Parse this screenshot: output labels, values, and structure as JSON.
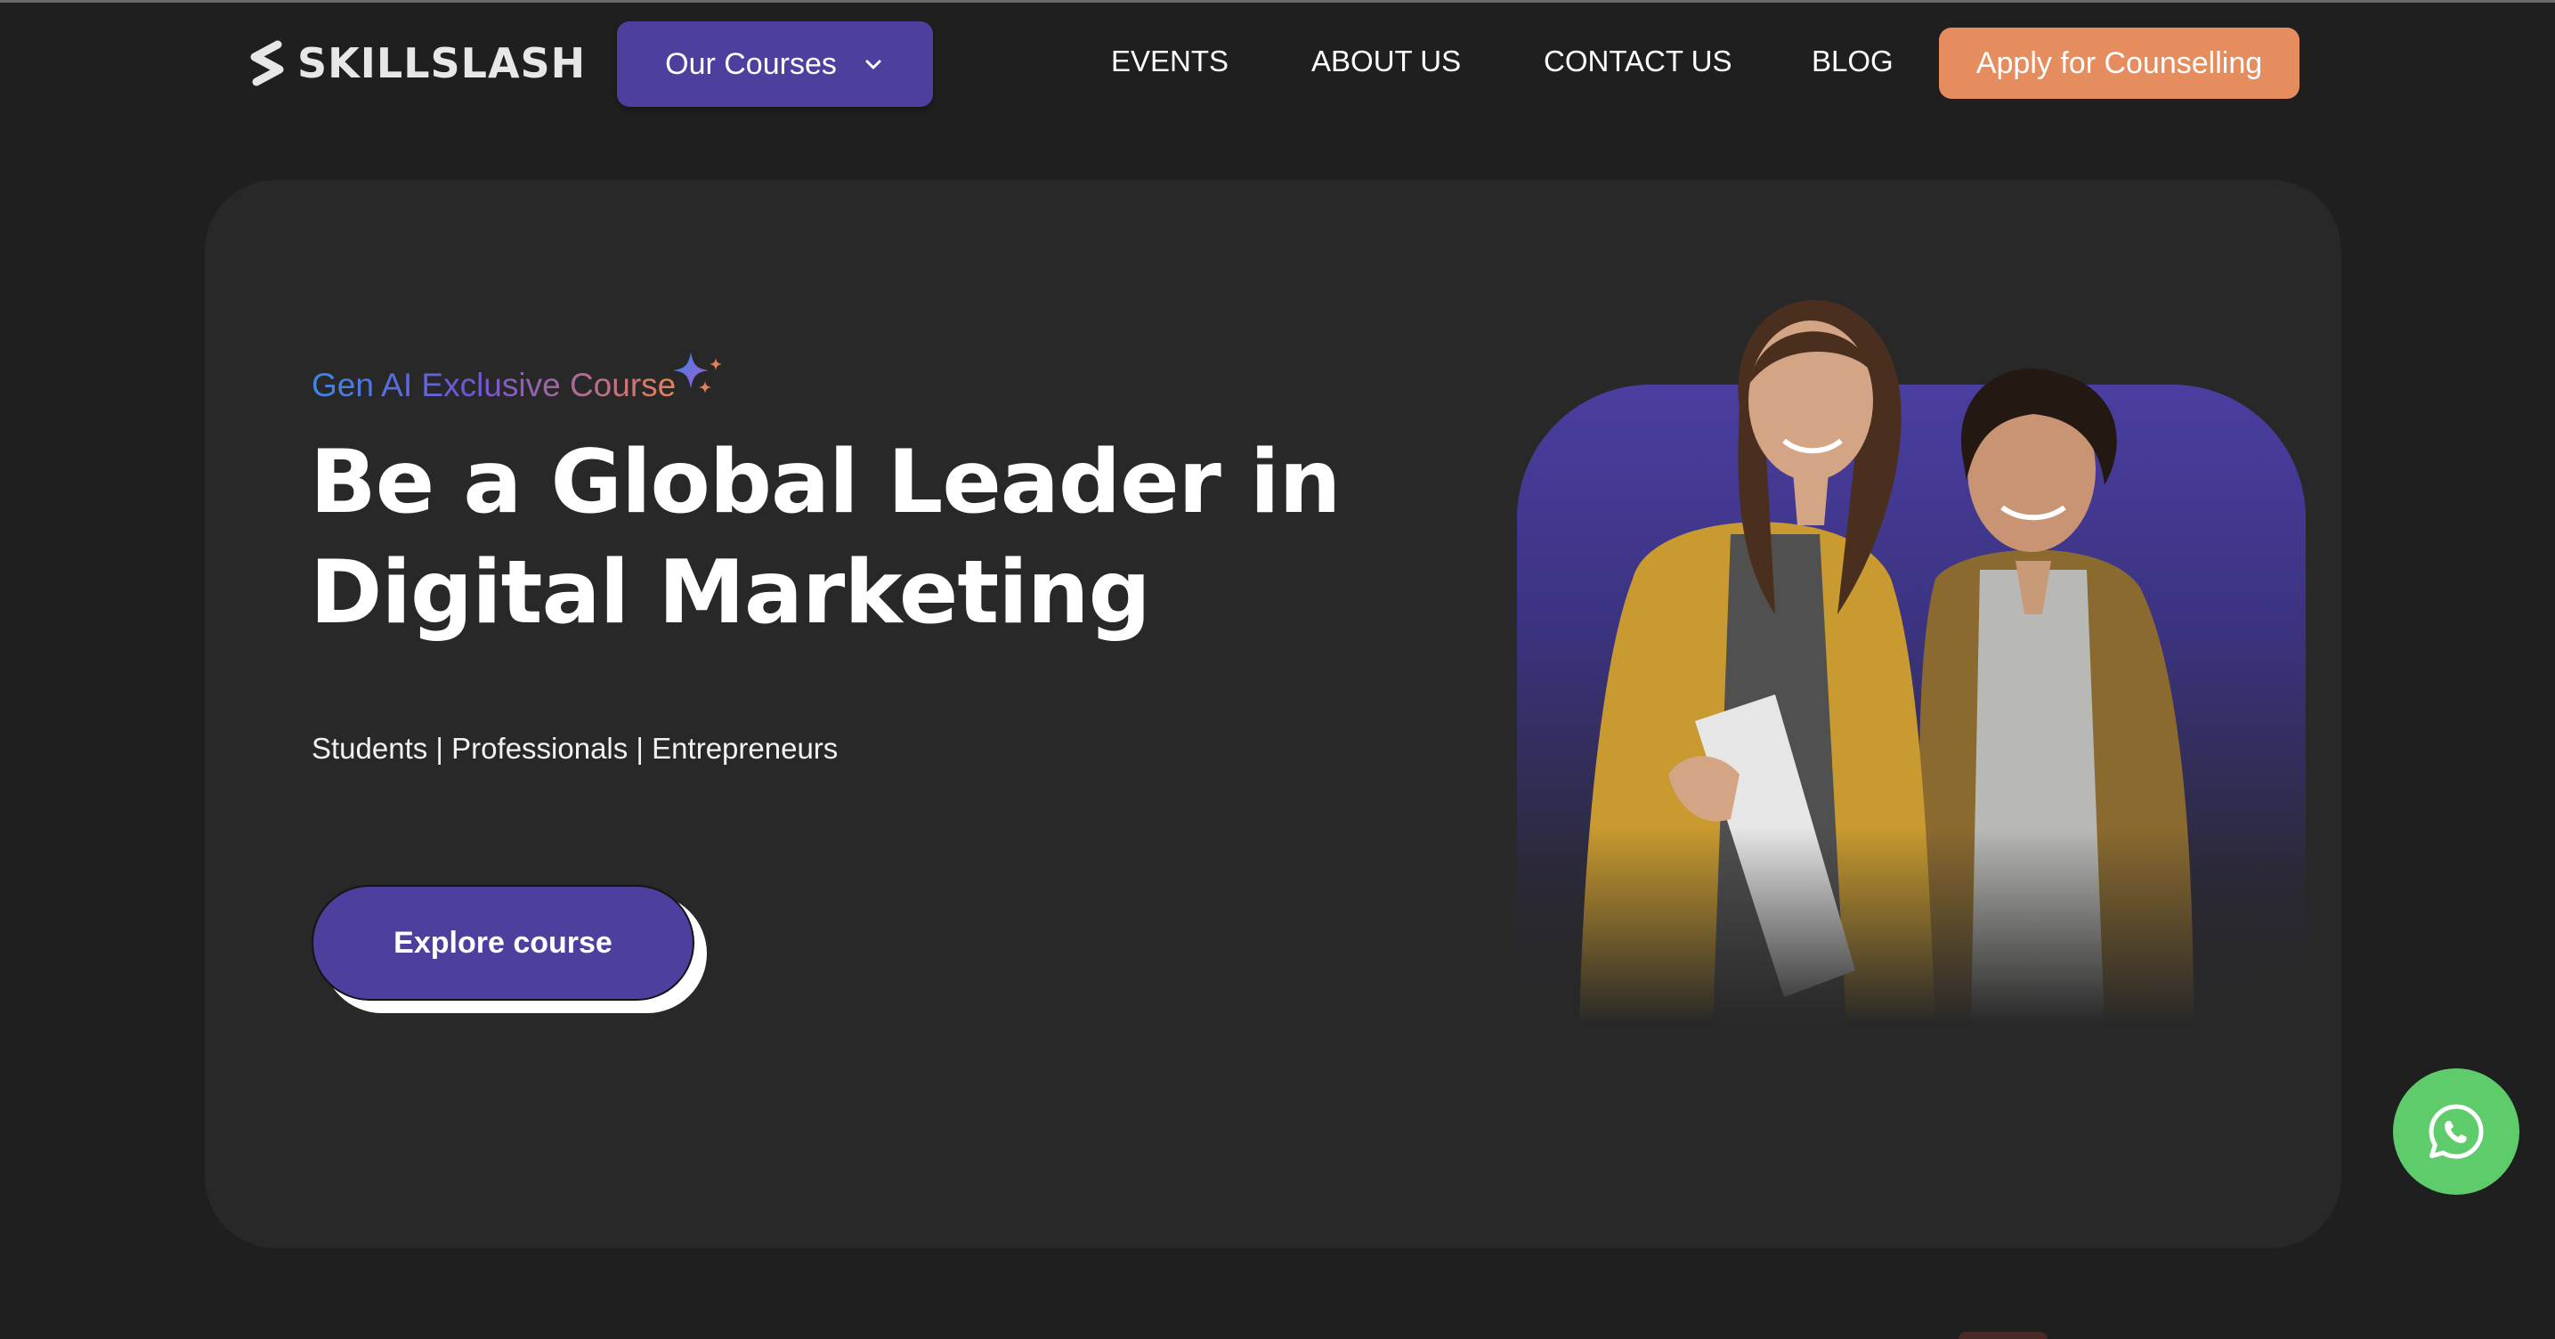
{
  "brand": {
    "logo_text": "SKILLSLASH",
    "logo_icon": "s-slash-logo-icon"
  },
  "header": {
    "courses_button": "Our Courses",
    "nav": [
      {
        "label": "EVENTS"
      },
      {
        "label": "ABOUT US"
      },
      {
        "label": "CONTACT US"
      },
      {
        "label": "BLOG"
      }
    ],
    "cta": "Apply for Counselling"
  },
  "hero": {
    "tag": "Gen AI Exclusive Course",
    "tag_icon": "sparkle-icon",
    "headline_line1": "Be a Global Leader in",
    "headline_line2": "Digital Marketing",
    "audience": "Students | Professionals | Entrepreneurs",
    "button": "Explore course",
    "image": "students-photo"
  },
  "floating": {
    "whatsapp_icon": "whatsapp-icon"
  },
  "colors": {
    "background": "#1f1f20",
    "card": "#282828",
    "primary": "#4d3f9e",
    "accent": "#e58d5f",
    "whatsapp": "#5ecc6b"
  }
}
